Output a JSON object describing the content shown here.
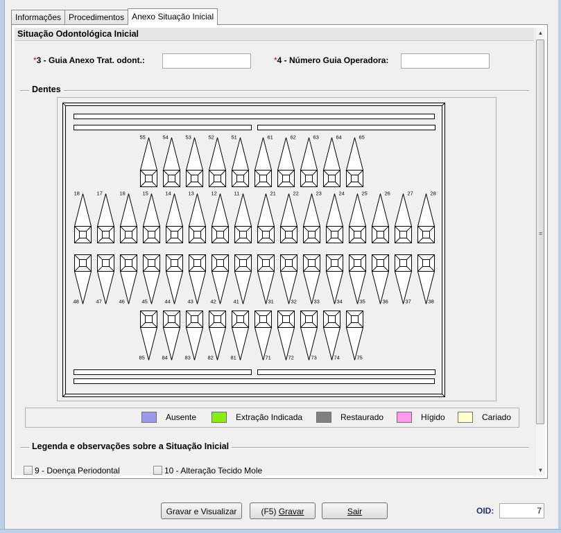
{
  "tabs": [
    {
      "label": "Informações",
      "active": false
    },
    {
      "label": "Procedimentos",
      "active": false
    },
    {
      "label": "Anexo Situação Inicial",
      "active": true
    }
  ],
  "section_title": "Situação Odontológica Inicial",
  "fields": {
    "guia_anexo": {
      "required_mark": "*",
      "label": "3 - Guia Anexo Trat. odont.:",
      "value": ""
    },
    "numero_guia": {
      "required_mark": "*",
      "label": "4 - Número Guia Operadora:",
      "value": ""
    }
  },
  "dentes_group": {
    "title": "Dentes"
  },
  "teeth": {
    "upper_primary": [
      "55",
      "54",
      "53",
      "52",
      "51",
      "61",
      "62",
      "63",
      "64",
      "65"
    ],
    "upper_permanent": [
      "18",
      "17",
      "16",
      "15",
      "14",
      "13",
      "12",
      "11",
      "21",
      "22",
      "23",
      "24",
      "25",
      "26",
      "27",
      "28"
    ],
    "lower_permanent": [
      "48",
      "47",
      "46",
      "45",
      "44",
      "43",
      "42",
      "41",
      "31",
      "32",
      "33",
      "34",
      "35",
      "36",
      "37",
      "38"
    ],
    "lower_primary": [
      "85",
      "84",
      "83",
      "82",
      "81",
      "71",
      "72",
      "73",
      "74",
      "75"
    ]
  },
  "legend": [
    {
      "label": "Ausente",
      "color": "#9999ee",
      "icon": "swatch-ausente"
    },
    {
      "label": "Extração Indicada",
      "color": "#88ee11",
      "icon": "swatch-extracao"
    },
    {
      "label": "Restaurado",
      "color": "#808080",
      "icon": "swatch-restaurado"
    },
    {
      "label": "Hígido",
      "color": "#ff99ee",
      "icon": "swatch-higido"
    },
    {
      "label": "Cariado",
      "color": "#ffffcc",
      "icon": "swatch-cariado"
    }
  ],
  "obs_group": {
    "title": "Legenda e observações sobre a Situação Inicial"
  },
  "checkboxes": [
    {
      "label": "9 - Doença Periodontal",
      "checked": false
    },
    {
      "label": "10 - Alteração Tecido Mole",
      "checked": false
    }
  ],
  "buttons": {
    "gravar_visualizar": "Gravar e Visualizar",
    "gravar_prefix": "(F5) ",
    "gravar_label": "Gravar",
    "sair": "Sair"
  },
  "oid": {
    "label": "OID:",
    "value": "7"
  }
}
